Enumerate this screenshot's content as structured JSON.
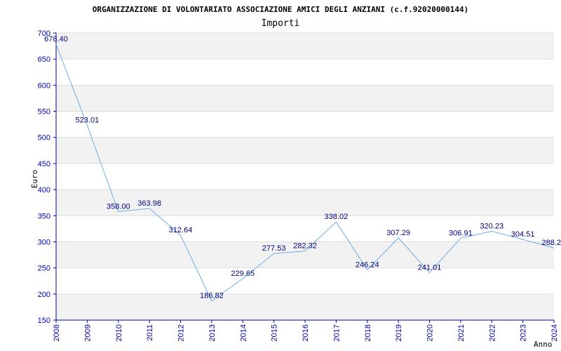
{
  "chart_data": {
    "type": "line",
    "title": "ORGANIZZAZIONE DI VOLONTARIATO ASSOCIAZIONE AMICI DEGLI ANZIANI (c.f.92020000144)",
    "subtitle": "Importi",
    "xlabel": "Anno",
    "ylabel": "Euro",
    "x": [
      "2008",
      "2009",
      "2010",
      "2011",
      "2012",
      "2013",
      "2014",
      "2015",
      "2016",
      "2017",
      "2018",
      "2019",
      "2020",
      "2021",
      "2022",
      "2023",
      "2024"
    ],
    "values": [
      678.4,
      523.01,
      358.0,
      363.98,
      312.64,
      186.82,
      229.65,
      277.53,
      282.32,
      338.02,
      246.24,
      307.29,
      241.01,
      306.91,
      320.23,
      304.51,
      288.2
    ],
    "value_labels": [
      "678.40",
      "523.01",
      "358.00",
      "363.98",
      "312.64",
      "186.82",
      "229.65",
      "277.53",
      "282.32",
      "338.02",
      "246.24",
      "307.29",
      "241.01",
      "306.91",
      "320.23",
      "304.51",
      "288.2"
    ],
    "ylim": [
      150,
      700
    ],
    "yticks": [
      "150",
      "200",
      "250",
      "300",
      "350",
      "400",
      "450",
      "500",
      "550",
      "600",
      "650",
      "700"
    ],
    "grid": "horizontal bands",
    "line_color": "#6aaee6",
    "band_color": "#f2f2f2",
    "axis_color": "#0000aa"
  }
}
